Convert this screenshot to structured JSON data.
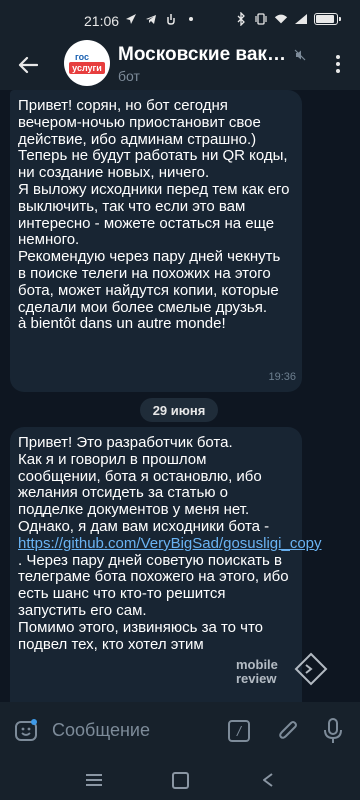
{
  "status_bar": {
    "time": "21:06"
  },
  "header": {
    "title": "Московские вакци…",
    "subtitle": "бот",
    "avatar_top": "гос",
    "avatar_bottom": "услуги"
  },
  "messages": [
    {
      "text": "Привет! сорян, но бот сегодня вечером-ночью приостановит свое действие, ибо админам страшно.)\nТеперь не будут работать ни QR коды, ни создание новых, ничего.\nЯ выложу исходники перед тем как его выключить, так что если это вам интересно - можете остаться на еще немного.\nРекомендую через пару дней чекнуть в поиске телеги на похожих на этого бота, может найдутся копии, которые сделали мои более смелые друзья.\nà bientôt dans un autre monde!",
      "time": "19:36"
    },
    {
      "text_before_link": "Привет! Это разработчик бота.\nКак я и говорил в прошлом сообщении, бота я остановлю, ибо желания отсидеть за статью о подделке документов у меня нет. Однако, я дам вам исходники бота - ",
      "link": "https://github.com/VeryBigSad/gosusligi_copy",
      "text_after_link": " . Через пару дней советую поискать в телеграме бота похожего на этого, ибо есть шанс что кто-то решится запустить его сам.\nПомимо этого, извиняюсь за то что подвел тех, кто хотел этим"
    }
  ],
  "date_divider": "29 июня",
  "input": {
    "placeholder": "Сообщение"
  },
  "watermark": {
    "line1": "mobile",
    "line2": "review"
  },
  "icons": [
    "back-arrow-icon",
    "mute-icon",
    "more-vert-icon",
    "emoji-icon",
    "command-icon",
    "attach-icon",
    "mic-icon"
  ],
  "colors": {
    "background": "#0e1621",
    "bar": "#17212b",
    "bubble": "#182533",
    "link": "#6ab3f3",
    "muted_text": "#7d8b99"
  }
}
